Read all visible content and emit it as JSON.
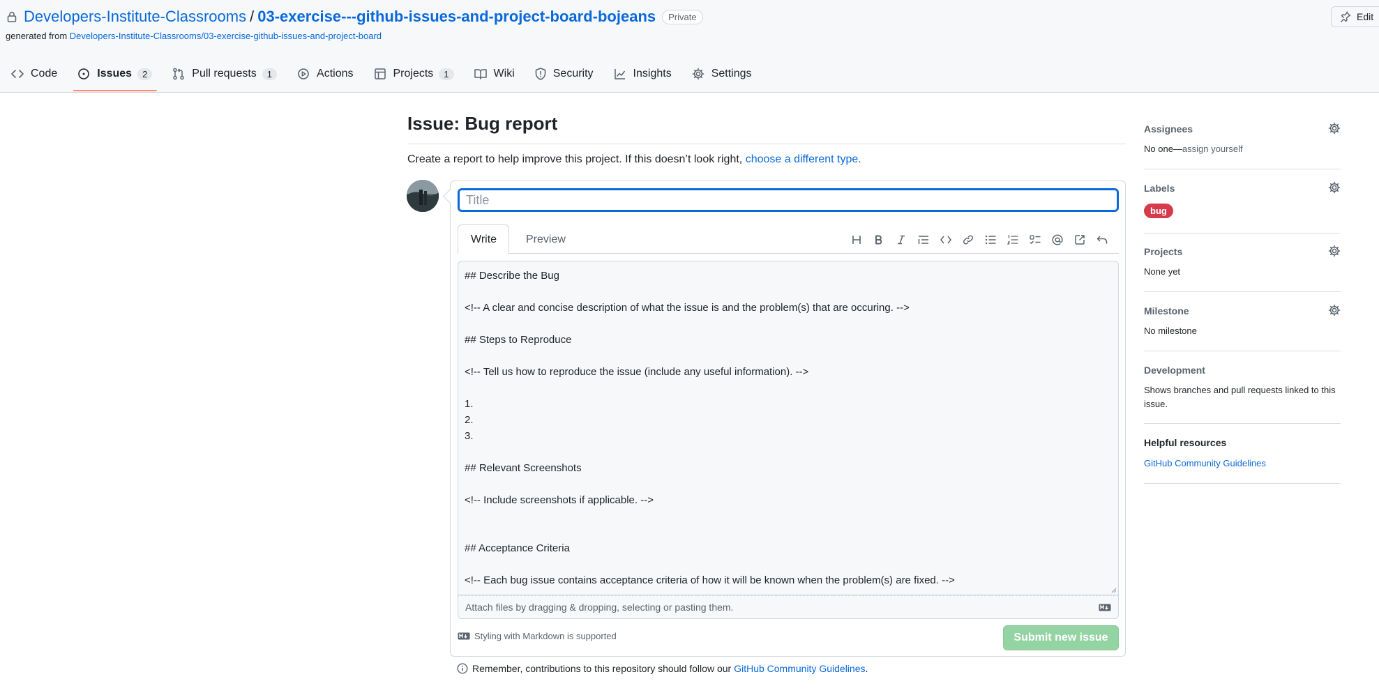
{
  "header": {
    "owner": "Developers-Institute-Classrooms",
    "separator": "/",
    "repo": "03-exercise---github-issues-and-project-board-bojeans",
    "visibility": "Private",
    "generated_prefix": "generated from",
    "generated_link": "Developers-Institute-Classrooms/03-exercise-github-issues-and-project-board",
    "edit_label": "Edit"
  },
  "nav": {
    "code": "Code",
    "issues": "Issues",
    "issues_count": "2",
    "pulls": "Pull requests",
    "pulls_count": "1",
    "actions": "Actions",
    "projects": "Projects",
    "projects_count": "1",
    "wiki": "Wiki",
    "security": "Security",
    "insights": "Insights",
    "settings": "Settings"
  },
  "issue": {
    "heading": "Issue: Bug report",
    "subtitle": "Create a report to help improve this project. If this doesn’t look right,",
    "subtitle_link": "choose a different type.",
    "title_placeholder": "Title",
    "tab_write": "Write",
    "tab_preview": "Preview",
    "body_lines": [
      "## Describe the Bug",
      "",
      "<!-- A clear and concise description of what the issue is and the problem(s) that are occuring. -->",
      "",
      "## Steps to Reproduce",
      "",
      "<!-- Tell us how to reproduce the issue (include any useful information). -->",
      "",
      "1.",
      "2.",
      "3.",
      "",
      "## Relevant Screenshots",
      "",
      "<!-- Include screenshots if applicable. -->",
      "",
      "",
      "## Acceptance Criteria",
      "",
      "<!-- Each bug issue contains acceptance criteria of how it will be known when the problem(s) are fixed. -->"
    ],
    "attach_text": "Attach files by dragging & dropping, selecting or pasting them.",
    "markdown_note": "Styling with Markdown is supported",
    "submit_label": "Submit new issue",
    "remember_text": "Remember, contributions to this repository should follow our",
    "remember_link": "GitHub Community Guidelines",
    "remember_end": "."
  },
  "sidebar": {
    "assignees_head": "Assignees",
    "assignees_none": "No one—",
    "assignees_self": "assign yourself",
    "labels_head": "Labels",
    "label_bug": "bug",
    "projects_head": "Projects",
    "projects_value": "None yet",
    "milestone_head": "Milestone",
    "milestone_value": "No milestone",
    "development_head": "Development",
    "development_value": "Shows branches and pull requests linked to this issue.",
    "resources_head": "Helpful resources",
    "resources_link": "GitHub Community Guidelines"
  },
  "colors": {
    "link": "#0969da",
    "label_bug": "#d73a4a",
    "submit_disabled": "#94d3a2",
    "active_tab_underline": "#fd8c73"
  }
}
